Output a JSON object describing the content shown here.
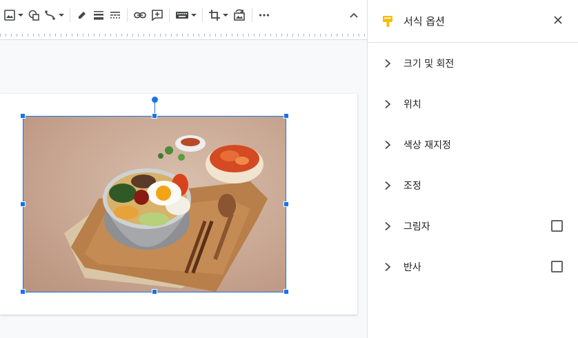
{
  "panel": {
    "title": "서식 옵션",
    "sections": [
      {
        "label": "크기 및 회전",
        "has_checkbox": false
      },
      {
        "label": "위치",
        "has_checkbox": false
      },
      {
        "label": "색상 재지정",
        "has_checkbox": false
      },
      {
        "label": "조정",
        "has_checkbox": false
      },
      {
        "label": "그림자",
        "has_checkbox": true,
        "checked": false
      },
      {
        "label": "반사",
        "has_checkbox": true,
        "checked": false
      }
    ]
  },
  "colors": {
    "accent": "#1a73e8",
    "panel_icon": "#fbbc04"
  },
  "toolbar": {
    "icons": [
      "image-icon",
      "shape-icon",
      "line-icon",
      "pen-color-icon",
      "line-weight-icon",
      "line-dash-icon",
      "link-icon",
      "comment-add-icon",
      "keyboard-icon",
      "crop-icon",
      "replace-image-icon",
      "more-icon",
      "collapse-icon"
    ]
  },
  "image": {
    "subject": "bibimbap-photo"
  }
}
